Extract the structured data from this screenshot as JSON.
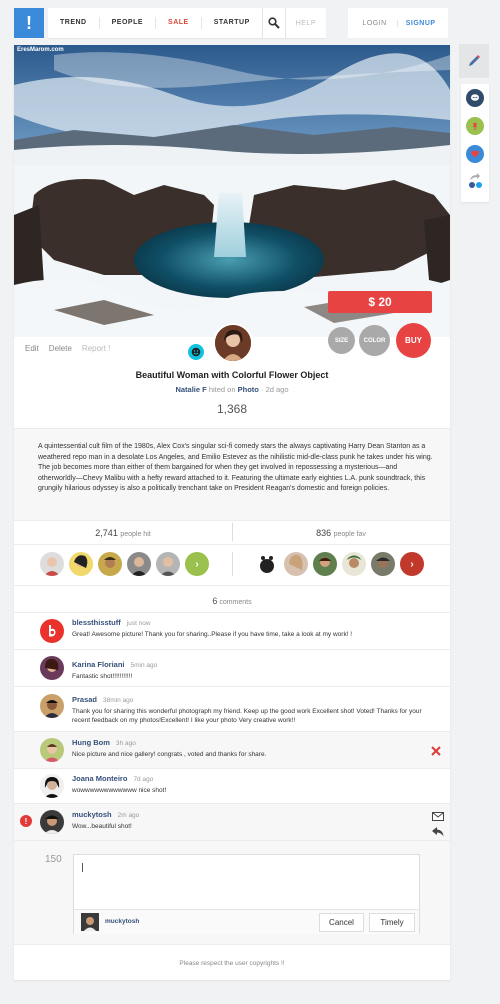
{
  "nav": {
    "logo_glyph": "!",
    "items": [
      "TREND",
      "PEOPLE",
      "SALE",
      "STARTUP"
    ],
    "help": "HELP",
    "login": "LOGIN",
    "signup": "SIGNUP"
  },
  "hero": {
    "watermark": "EresMarom.com",
    "price": "$ 20",
    "size_label": "SIZE",
    "color_label": "COLOR",
    "buy_label": "BUY"
  },
  "post": {
    "actions": [
      "Edit",
      "Delete",
      "Report !"
    ],
    "title": "Beautiful Woman with Colorful Flower Object",
    "author": "Natalie F",
    "hited_on": "hited on",
    "category": "Photo",
    "time": "2d ago",
    "hits": "1,368",
    "description": "A quintessential cult film of the 1980s, Alex Cox's singular sci-fi comedy stars the always captivating Harry Dean Stanton as a weathered repo man in a desolate Los Angeles, and Emilio Estevez as the nihilistic mid-dle-class punk he takes under his wing. The job becomes more than either of them bargained for when they get involved in repossessing a mysterious—and otherworldly—Chevy Malibu with a hefty reward attached to it. Featuring the ultimate early eighties L.A. punk soundtrack, this grungily hilarious odyssey is also a politically trenchant take on President Reagan's domestic and foreign policies."
  },
  "stats": {
    "hits_count": "2,741",
    "hits_label": "people hit",
    "fav_count": "836",
    "fav_label": "people fav"
  },
  "comments_header": {
    "count": "6",
    "label": "comments"
  },
  "comments": [
    {
      "name": "blessthisstuff",
      "time": "just now",
      "text": "Great! Awesome picture! Thank you for sharing..Please if you have time, take a look at my work! !"
    },
    {
      "name": "Karina Floriani",
      "time": "5min ago",
      "text": "Fantastic shot!!!!!!!!!!!"
    },
    {
      "name": "Prasad",
      "time": "38min ago",
      "text": "Thank you for sharing this wonderful photograph my friend. Keep up the good work Excellent shot! Voted! Thanks for your recent feedback on my photos!Excellent! I like your photo Very creative work!!"
    },
    {
      "name": "Hung Bom",
      "time": "3h ago",
      "text": "Nice picture and nice gallery! congrats , voted and thanks for share."
    },
    {
      "name": "Joana Monteiro",
      "time": "7d ago",
      "text": "wowwwwwwwwwwww nice shot!"
    },
    {
      "name": "muckytosh",
      "time": "2m ago",
      "text": "Wow...beautiful shot!"
    }
  ],
  "composer": {
    "char_count": "150",
    "user": "muckytosh",
    "cancel": "Cancel",
    "submit": "Timely"
  },
  "footer": {
    "copyright": "Please respect the user copyrights !!"
  },
  "colors": {
    "brand_blue": "#3b8ad9",
    "accent_red": "#e84343",
    "link_navy": "#35507a",
    "smile_cyan": "#11c3e0"
  }
}
